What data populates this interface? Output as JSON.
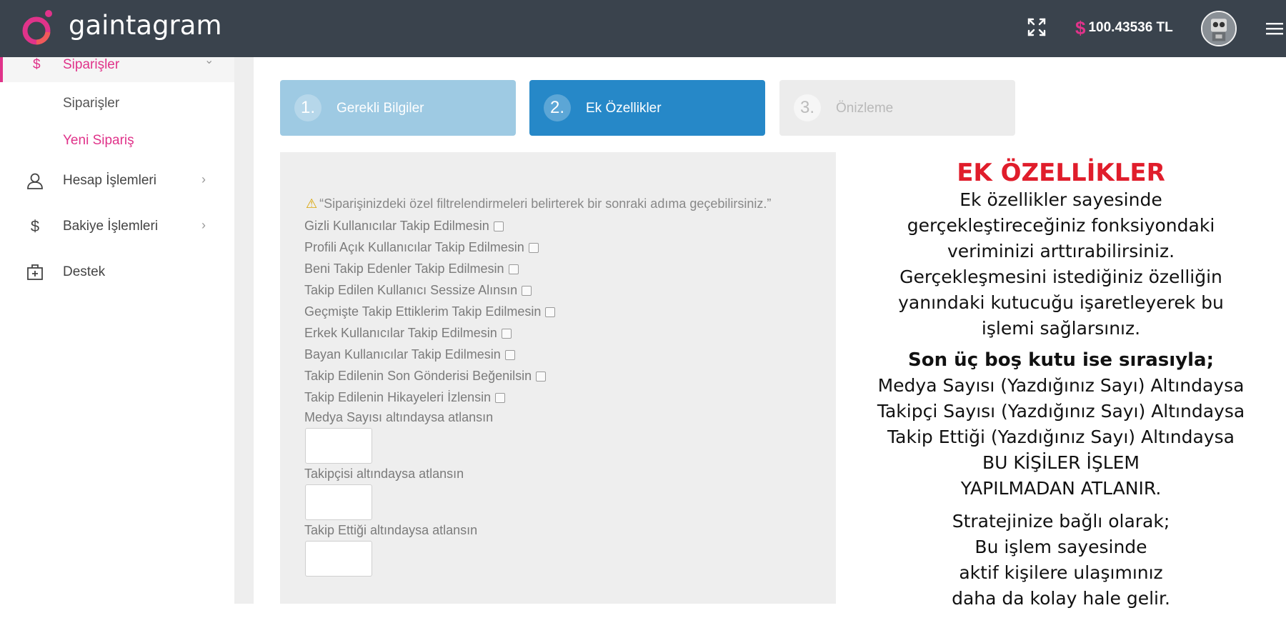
{
  "app": {
    "name": "gaintagram"
  },
  "header": {
    "balance_symbol": "$",
    "balance": "100.43536 TL"
  },
  "sidebar": {
    "active": "Siparişler",
    "sub_items": [
      "Siparişler",
      "Yeni Sipariş"
    ],
    "items": [
      {
        "label": "Hesap İşlemleri",
        "icon": "user-icon"
      },
      {
        "label": "Bakiye İşlemleri",
        "icon": "dollar-icon"
      },
      {
        "label": "Destek",
        "icon": "medkit-icon"
      }
    ]
  },
  "steps": [
    {
      "num": "1.",
      "label": "Gerekli Bilgiler"
    },
    {
      "num": "2.",
      "label": "Ek Özellikler"
    },
    {
      "num": "3.",
      "label": "Önizleme"
    }
  ],
  "form": {
    "warning": "“Siparişinizdeki özel filtrelendirmeleri belirterek bir sonraki adıma geçebilirsiniz.”",
    "options": [
      "Gizli Kullanıcılar Takip Edilmesin",
      "Profili Açık Kullanıcılar Takip Edilmesin",
      "Beni Takip Edenler Takip Edilmesin",
      "Takip Edilen Kullanıcı Sessize Alınsın",
      "Geçmişte Takip Ettiklerim Takip Edilmesin",
      "Erkek Kullanıcılar Takip Edilmesin",
      "Bayan Kullanıcılar Takip Edilmesin",
      "Takip Edilenin Son Gönderisi Beğenilsin",
      "Takip Edilenin Hikayeleri İzlensin"
    ],
    "numeric_labels": [
      "Medya Sayısı altındaysa atlansın",
      "Takipçisi altındaysa atlansın",
      "Takip Ettiği altındaysa atlansın"
    ]
  },
  "info": {
    "title": "EK ÖZELLİKLER",
    "p1": [
      "Ek özellikler sayesinde",
      "gerçekleştireceğiniz fonksiyondaki",
      "veriminizi arttırabilirsiniz.",
      "Gerçekleşmesini istediğiniz özelliğin",
      "yanındaki kutucuğu işaretleyerek bu",
      "işlemi sağlarsınız."
    ],
    "bold": "Son üç boş kutu ise sırasıyla;",
    "p2": [
      "Medya Sayısı (Yazdığınız Sayı) Altındaysa",
      "Takipçi Sayısı (Yazdığınız Sayı) Altındaysa",
      "Takip Ettiği (Yazdığınız Sayı) Altındaysa",
      "BU KİŞİLER İŞLEM",
      "YAPILMADAN ATLANIR."
    ],
    "p3": [
      "Stratejinize bağlı olarak;",
      "Bu işlem sayesinde",
      "aktif kişilere ulaşımınız",
      "daha da kolay hale gelir."
    ]
  }
}
